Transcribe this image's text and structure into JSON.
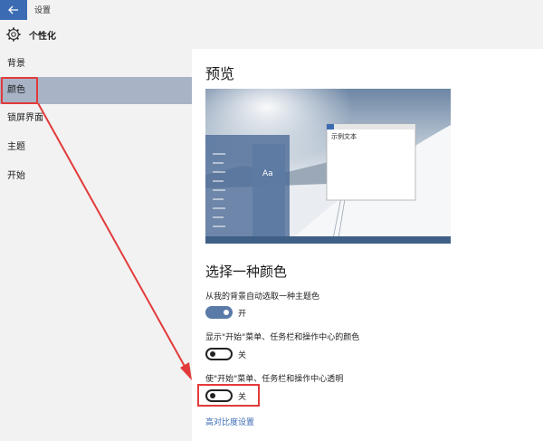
{
  "window": {
    "title": "设置"
  },
  "header": {
    "title": "个性化"
  },
  "sidebar": {
    "items": [
      {
        "label": "背景"
      },
      {
        "label": "颜色"
      },
      {
        "label": "锁屏界面"
      },
      {
        "label": "主题"
      },
      {
        "label": "开始"
      }
    ]
  },
  "main": {
    "preview_heading": "预览",
    "preview": {
      "tile_label": "Aa",
      "sample_text": "示例文本"
    },
    "choose_heading": "选择一种颜色",
    "settings": [
      {
        "label": "从我的背景自动选取一种主题色",
        "state": "开",
        "on": true
      },
      {
        "label": "显示\"开始\"菜单、任务栏和操作中心的颜色",
        "state": "关",
        "on": false
      },
      {
        "label": "使\"开始\"菜单、任务栏和操作中心透明",
        "state": "关",
        "on": false
      }
    ],
    "high_contrast_link": "高对比度设置"
  },
  "colors": {
    "accent": "#3b6bb3",
    "selected_bg": "#a9b3c6",
    "annotation": "#e23a3a"
  }
}
